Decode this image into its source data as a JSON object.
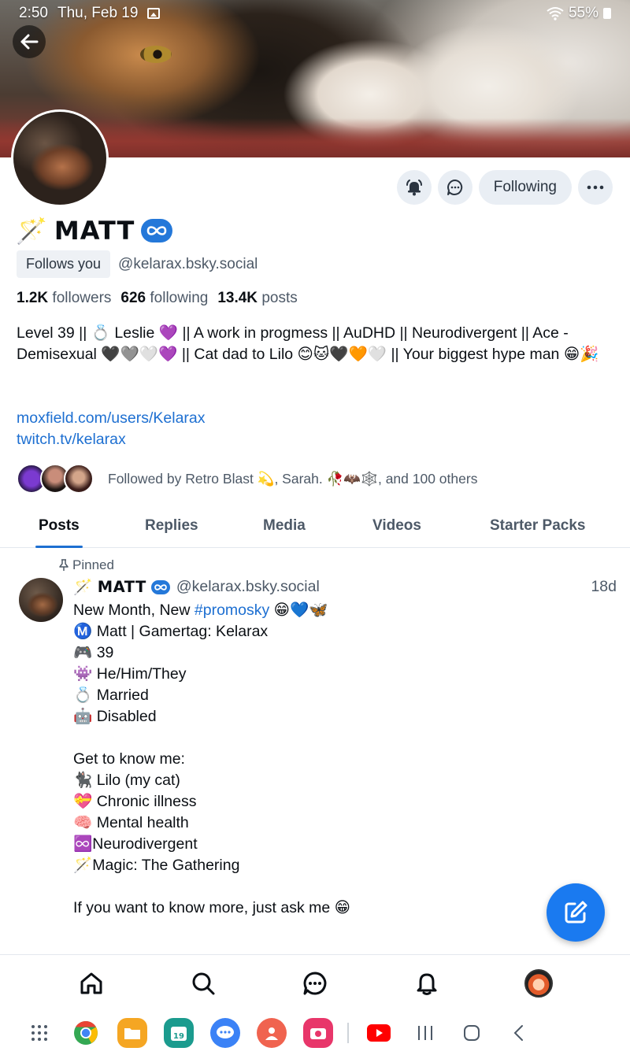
{
  "status_bar": {
    "time": "2:50",
    "date": "Thu, Feb 19",
    "battery": "55%"
  },
  "profile": {
    "display_name": "MATT",
    "follows_you_label": "Follows you",
    "handle": "@kelarax.bsky.social",
    "followers_count": "1.2K",
    "followers_label": "followers",
    "following_count": "626",
    "following_label": "following",
    "posts_count": "13.4K",
    "posts_label": "posts",
    "bio": "Level 39 || 💍 Leslie 💜 || A work in progmess || AuDHD || Neurodivergent || Ace - Demisexual 🖤🩶🤍💜 || Cat dad to Lilo 😊🐱🖤🧡🤍 || Your biggest hype man 😁🎉",
    "links": [
      "moxfield.com/users/Kelarax",
      "twitch.tv/kelarax"
    ],
    "followed_by": "Followed by Retro Blast 💫, Sarah. 🥀🦇🕸️, and 100 others"
  },
  "actions": {
    "following_label": "Following"
  },
  "tabs": [
    "Posts",
    "Replies",
    "Media",
    "Videos",
    "Starter Packs"
  ],
  "post": {
    "pinned_label": "Pinned",
    "author": "MATT",
    "handle": "@kelarax.bsky.social",
    "time": "18d",
    "line1_prefix": "New Month, New ",
    "hashtag": "#promosky",
    "line1_suffix": " 😁💙🦋",
    "body": "\nⓂ️ Matt | Gamertag: Kelarax\n🎮 39\n👾 He/Him/They\n💍 Married\n🤖 Disabled\n\nGet to know me:\n🐈‍⬛ Lilo (my cat)\n💝 Chronic illness\n🧠 Mental health\n♾️Neurodivergent\n🪄Magic: The Gathering\n\nIf you want to know more, just ask me 😁"
  },
  "colors": {
    "accent": "#1d6fd1",
    "fab": "#1a7af0",
    "badge": "#2478d9"
  }
}
